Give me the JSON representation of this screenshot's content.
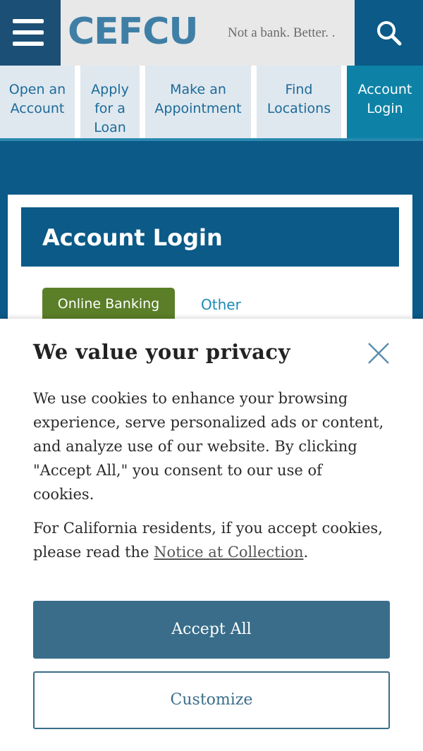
{
  "header": {
    "logo": "CEFCU",
    "tagline": "Not a bank. Better. ."
  },
  "quicklinks": [
    {
      "label": "Open an Account"
    },
    {
      "label": "Apply for a Loan"
    },
    {
      "label": "Make an Appointment"
    },
    {
      "label": "Find Locations"
    },
    {
      "label": "Account Login"
    }
  ],
  "login": {
    "title": "Account Login",
    "tab_online": "Online Banking",
    "tab_other": "Other"
  },
  "privacy": {
    "title": "We value your privacy",
    "body": "We use cookies to enhance your browsing experience, serve personalized ads or content, and analyze use of our website. By clicking \"Accept All,\" you consent to our use of cookies.",
    "california_prefix": "For California residents, if you accept cookies, please read the ",
    "notice_link": "Notice at Collection",
    "california_suffix": ".",
    "accept_label": "Accept All",
    "customize_label": "Customize"
  },
  "colors": {
    "brand_dark": "#0b5a87",
    "active_tab": "#0e82a6",
    "online_tab": "#5b7f28",
    "accept_button": "#396d8a"
  }
}
